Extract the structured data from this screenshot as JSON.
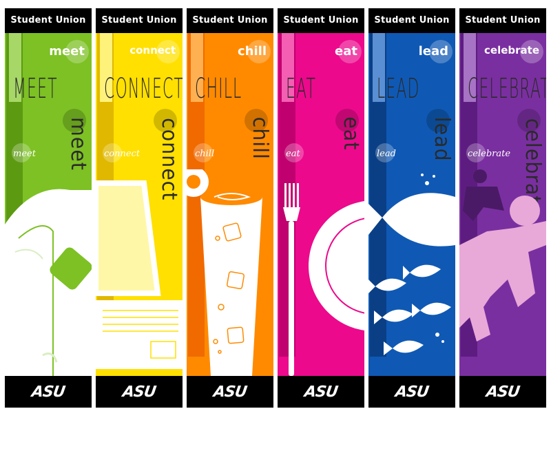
{
  "header_text": "Student Union",
  "footer_logo": "ASU",
  "banners": [
    {
      "id": "meet",
      "color": "#7dc124",
      "top_word": "meet",
      "big_word": "MEET",
      "small_word": "meet",
      "vertical_word": "meet"
    },
    {
      "id": "connect",
      "color": "#ffe000",
      "top_word": "connect",
      "big_word": "CONNECT",
      "small_word": "connect",
      "vertical_word": "connect"
    },
    {
      "id": "chill",
      "color": "#ff8a00",
      "top_word": "chill",
      "big_word": "CHILL",
      "small_word": "chill",
      "vertical_word": "chill"
    },
    {
      "id": "eat",
      "color": "#ec098c",
      "top_word": "eat",
      "big_word": "EAT",
      "small_word": "eat",
      "vertical_word": "eat"
    },
    {
      "id": "lead",
      "color": "#0f59b4",
      "top_word": "lead",
      "big_word": "LEAD",
      "small_word": "lead",
      "vertical_word": "lead"
    },
    {
      "id": "celebrate",
      "color": "#7a2fa0",
      "top_word": "celebrate",
      "big_word": "CELEBRATE",
      "small_word": "celebrate",
      "vertical_word": "celebrate"
    }
  ]
}
